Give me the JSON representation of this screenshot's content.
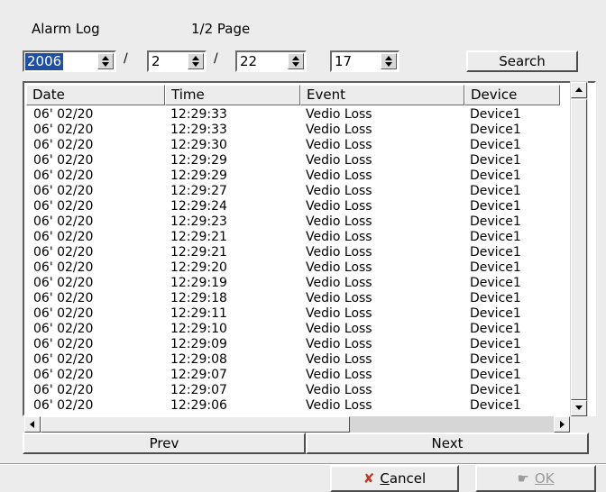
{
  "title": "Alarm Log",
  "page_info": "1/2 Page",
  "filter": {
    "year": "2006",
    "month": "2",
    "day": "22",
    "hour": "17",
    "separator": "/",
    "search_label": "Search"
  },
  "table": {
    "columns": [
      "Date",
      "Time",
      "Event",
      "Device"
    ],
    "rows": [
      [
        "06' 02/20",
        "12:29:33",
        "Vedio Loss",
        "Device1"
      ],
      [
        "06' 02/20",
        "12:29:33",
        "Vedio Loss",
        "Device1"
      ],
      [
        "06' 02/20",
        "12:29:30",
        "Vedio Loss",
        "Device1"
      ],
      [
        "06' 02/20",
        "12:29:29",
        "Vedio Loss",
        "Device1"
      ],
      [
        "06' 02/20",
        "12:29:29",
        "Vedio Loss",
        "Device1"
      ],
      [
        "06' 02/20",
        "12:29:27",
        "Vedio Loss",
        "Device1"
      ],
      [
        "06' 02/20",
        "12:29:24",
        "Vedio Loss",
        "Device1"
      ],
      [
        "06' 02/20",
        "12:29:23",
        "Vedio Loss",
        "Device1"
      ],
      [
        "06' 02/20",
        "12:29:21",
        "Vedio Loss",
        "Device1"
      ],
      [
        "06' 02/20",
        "12:29:21",
        "Vedio Loss",
        "Device1"
      ],
      [
        "06' 02/20",
        "12:29:20",
        "Vedio Loss",
        "Device1"
      ],
      [
        "06' 02/20",
        "12:29:19",
        "Vedio Loss",
        "Device1"
      ],
      [
        "06' 02/20",
        "12:29:18",
        "Vedio Loss",
        "Device1"
      ],
      [
        "06' 02/20",
        "12:29:11",
        "Vedio Loss",
        "Device1"
      ],
      [
        "06' 02/20",
        "12:29:10",
        "Vedio Loss",
        "Device1"
      ],
      [
        "06' 02/20",
        "12:29:09",
        "Vedio Loss",
        "Device1"
      ],
      [
        "06' 02/20",
        "12:29:08",
        "Vedio Loss",
        "Device1"
      ],
      [
        "06' 02/20",
        "12:29:07",
        "Vedio Loss",
        "Device1"
      ],
      [
        "06' 02/20",
        "12:29:07",
        "Vedio Loss",
        "Device1"
      ],
      [
        "06' 02/20",
        "12:29:06",
        "Vedio Loss",
        "Device1"
      ]
    ]
  },
  "pager": {
    "prev_label": "Prev",
    "next_label": "Next"
  },
  "footer": {
    "cancel_label": "Cancel",
    "ok_label": "OK",
    "cancel_icon": "cross-icon",
    "ok_icon": "hand-icon"
  },
  "colors": {
    "background": "#ececec",
    "selection": "#1e4fa0",
    "cancel_icon": "#c0392b"
  }
}
